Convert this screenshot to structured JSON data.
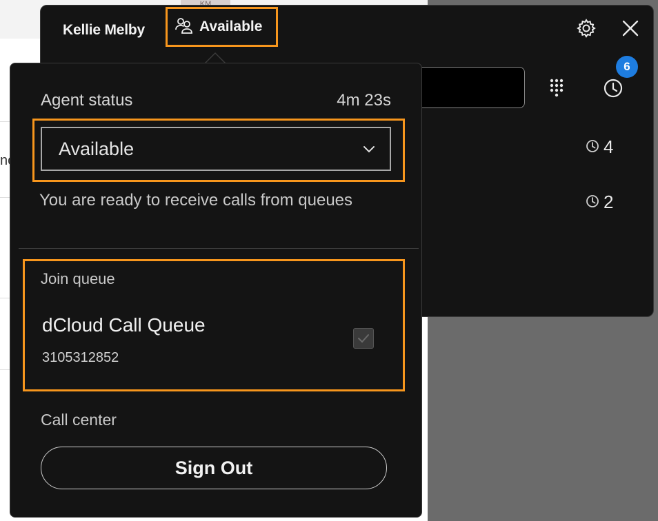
{
  "header": {
    "user_name": "Kellie Melby",
    "status_button_label": "Available",
    "history_badge_count": "6"
  },
  "background": {
    "avatar_initials": "KM",
    "cut_off_text": "nc"
  },
  "queue_summary": [
    {
      "count": "4"
    },
    {
      "count": "2"
    }
  ],
  "popover": {
    "agent_status_label": "Agent status",
    "status_timer": "4m 23s",
    "status_select_value": "Available",
    "status_description": "You are ready to receive calls from queues",
    "join_queue_label": "Join queue",
    "queue": {
      "name": "dCloud Call Queue",
      "number": "3105312852",
      "checked": true
    },
    "call_center_label": "Call center",
    "sign_out_label": "Sign Out"
  },
  "colors": {
    "highlight": "#f7961d",
    "badge": "#1e7de0",
    "panel": "#141414"
  },
  "icons": [
    "people-icon",
    "gear-icon",
    "close-icon",
    "keypad-icon",
    "clock-icon",
    "chevron-down-icon",
    "checkbox-check-icon"
  ]
}
